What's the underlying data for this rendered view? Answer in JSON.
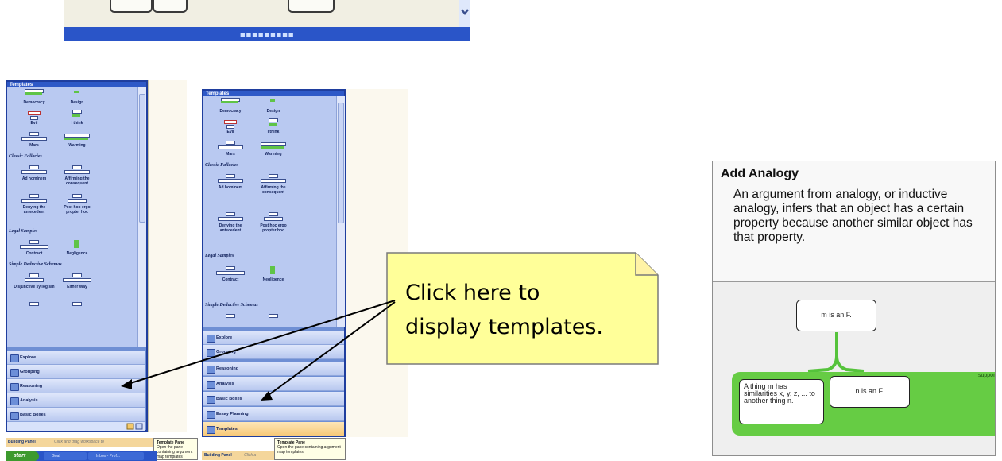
{
  "left_panel": {
    "title": "Templates",
    "templates": [
      {
        "label": "Democracy"
      },
      {
        "label": "Design"
      },
      {
        "label": "Evil"
      },
      {
        "label": "I think"
      },
      {
        "label": "Mars"
      },
      {
        "label": "Warming"
      },
      {
        "label": "Ad hominem"
      },
      {
        "label": "Affirming the consequent"
      },
      {
        "label": "Denying the antecedent"
      },
      {
        "label": "Post hoc ergo propter hoc"
      },
      {
        "label": "Contract"
      },
      {
        "label": "Negligence"
      },
      {
        "label": "Disjunctive syllogism"
      },
      {
        "label": "Either Way"
      }
    ],
    "sections": [
      "Classic Fallacies",
      "Legal Samples",
      "Simple Deductive Schemas"
    ],
    "nav": [
      "Explore",
      "Grouping",
      "Reasoning",
      "Analysis",
      "Basic Boxes"
    ],
    "building_panel": "Building Panel",
    "drag_hint": "Click and drag workspace to",
    "tooltip_title": "Template Pane",
    "tooltip_text": "Open the pane containing argument map templates",
    "taskbar": {
      "start": "start",
      "items": [
        "Goal",
        "Inbox - Prof..."
      ]
    }
  },
  "right_panel": {
    "title": "Templates",
    "templates": [
      {
        "label": "Democracy"
      },
      {
        "label": "Design"
      },
      {
        "label": "Evil"
      },
      {
        "label": "I think"
      },
      {
        "label": "Mars"
      },
      {
        "label": "Warming"
      },
      {
        "label": "Ad hominem"
      },
      {
        "label": "Affirming the consequent"
      },
      {
        "label": "Denying the antecedent"
      },
      {
        "label": "Post hoc ergo propter hoc"
      },
      {
        "label": "Contract"
      },
      {
        "label": "Negligence"
      }
    ],
    "sections": [
      "Classic Fallacies",
      "Legal Samples",
      "Simple Deductive Schemas"
    ],
    "nav": [
      "Explore",
      "Grouping",
      "Reasoning",
      "Analysis",
      "Basic Boxes",
      "Essay Planning",
      "Templates"
    ],
    "building_panel": "Building Panel",
    "drag_hint": "Click a",
    "tooltip_title": "Template Pane",
    "tooltip_text": "Open the pane containing argument map templates"
  },
  "callout": {
    "line1": "Click here to",
    "line2": "display templates."
  },
  "analogy_card": {
    "title": "Add Analogy",
    "description": "An argument from analogy, or inductive analogy, infers that an object has a certain property because another similar object has that property.",
    "claim_node": "m is an F.",
    "premise_left": "A thing m has similarities x, y, z, ... to another thing n.",
    "premise_right": "n is an F.",
    "support_label": "support"
  },
  "colors": {
    "panel_blue": "#6f8fd4",
    "title_blue": "#2e59c7",
    "callout_fill": "#ffff99",
    "support_green": "#66cc44"
  }
}
